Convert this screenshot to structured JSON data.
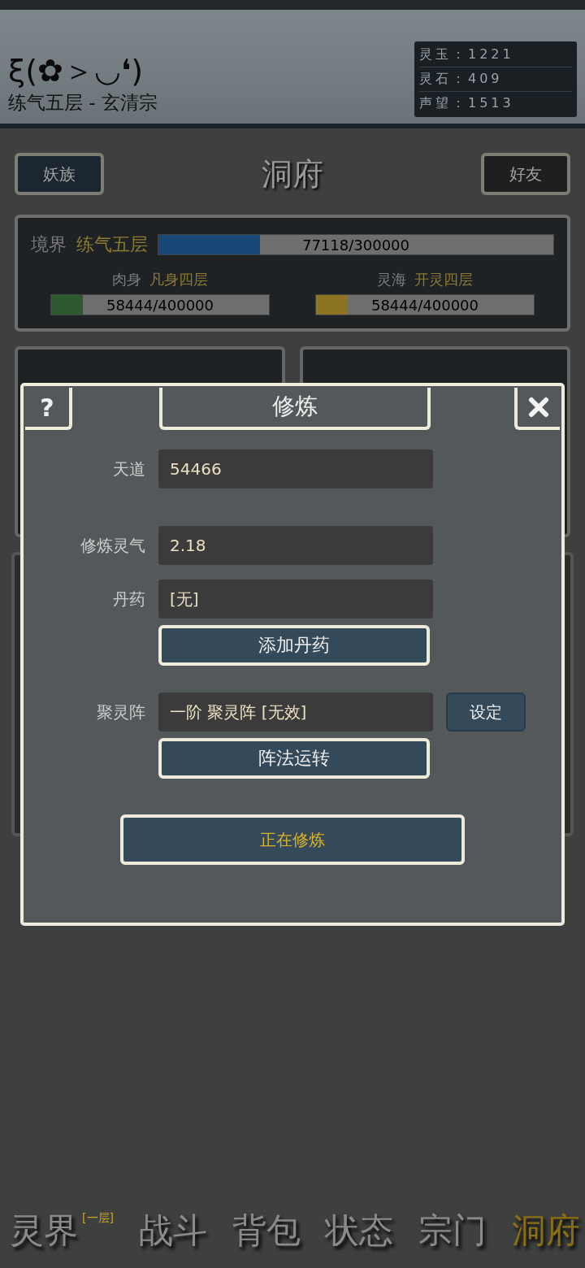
{
  "header": {
    "name": "ξ(✿＞◡❛)",
    "subtitle": "练气五层 - 玄清宗",
    "resources": [
      {
        "label": "灵玉：",
        "value": "1221"
      },
      {
        "label": "灵石：",
        "value": "409"
      },
      {
        "label": "声望：",
        "value": "1513"
      }
    ]
  },
  "top_bar": {
    "left_button": "妖族",
    "title": "洞府",
    "right_button": "好友"
  },
  "realm": {
    "label": "境界",
    "value": "练气五层",
    "level": 0.257,
    "reading": "77118/300000",
    "sub": [
      {
        "label": "肉身",
        "value": "凡身四层",
        "level": 0.146,
        "reading": "58444/400000",
        "color": "#2c5a2e"
      },
      {
        "label": "灵海",
        "value": "开灵四层",
        "level": 0.146,
        "reading": "58444/400000",
        "color": "#8c7420"
      }
    ]
  },
  "dialog": {
    "help": "?",
    "title": "修炼",
    "rows": [
      {
        "kind": "field",
        "label": "天道",
        "value": "54466"
      },
      {
        "kind": "gap"
      },
      {
        "kind": "field",
        "label": "修炼灵气",
        "value": "2.18"
      },
      {
        "kind": "field",
        "label": "丹药",
        "value": "[无]"
      },
      {
        "kind": "button",
        "label": "添加丹药"
      },
      {
        "kind": "field",
        "label": "聚灵阵",
        "value": "一阶 聚灵阵 [无效]",
        "button": "设定"
      },
      {
        "kind": "button",
        "label": "阵法运转"
      }
    ],
    "main_button": "正在修炼"
  },
  "nav": [
    {
      "label": "灵界",
      "badge": "[一层]",
      "selected": false
    },
    {
      "label": "战斗",
      "selected": false
    },
    {
      "label": "背包",
      "selected": false
    },
    {
      "label": "状态",
      "selected": false
    },
    {
      "label": "宗门",
      "selected": false
    },
    {
      "label": "洞府",
      "selected": true
    }
  ]
}
